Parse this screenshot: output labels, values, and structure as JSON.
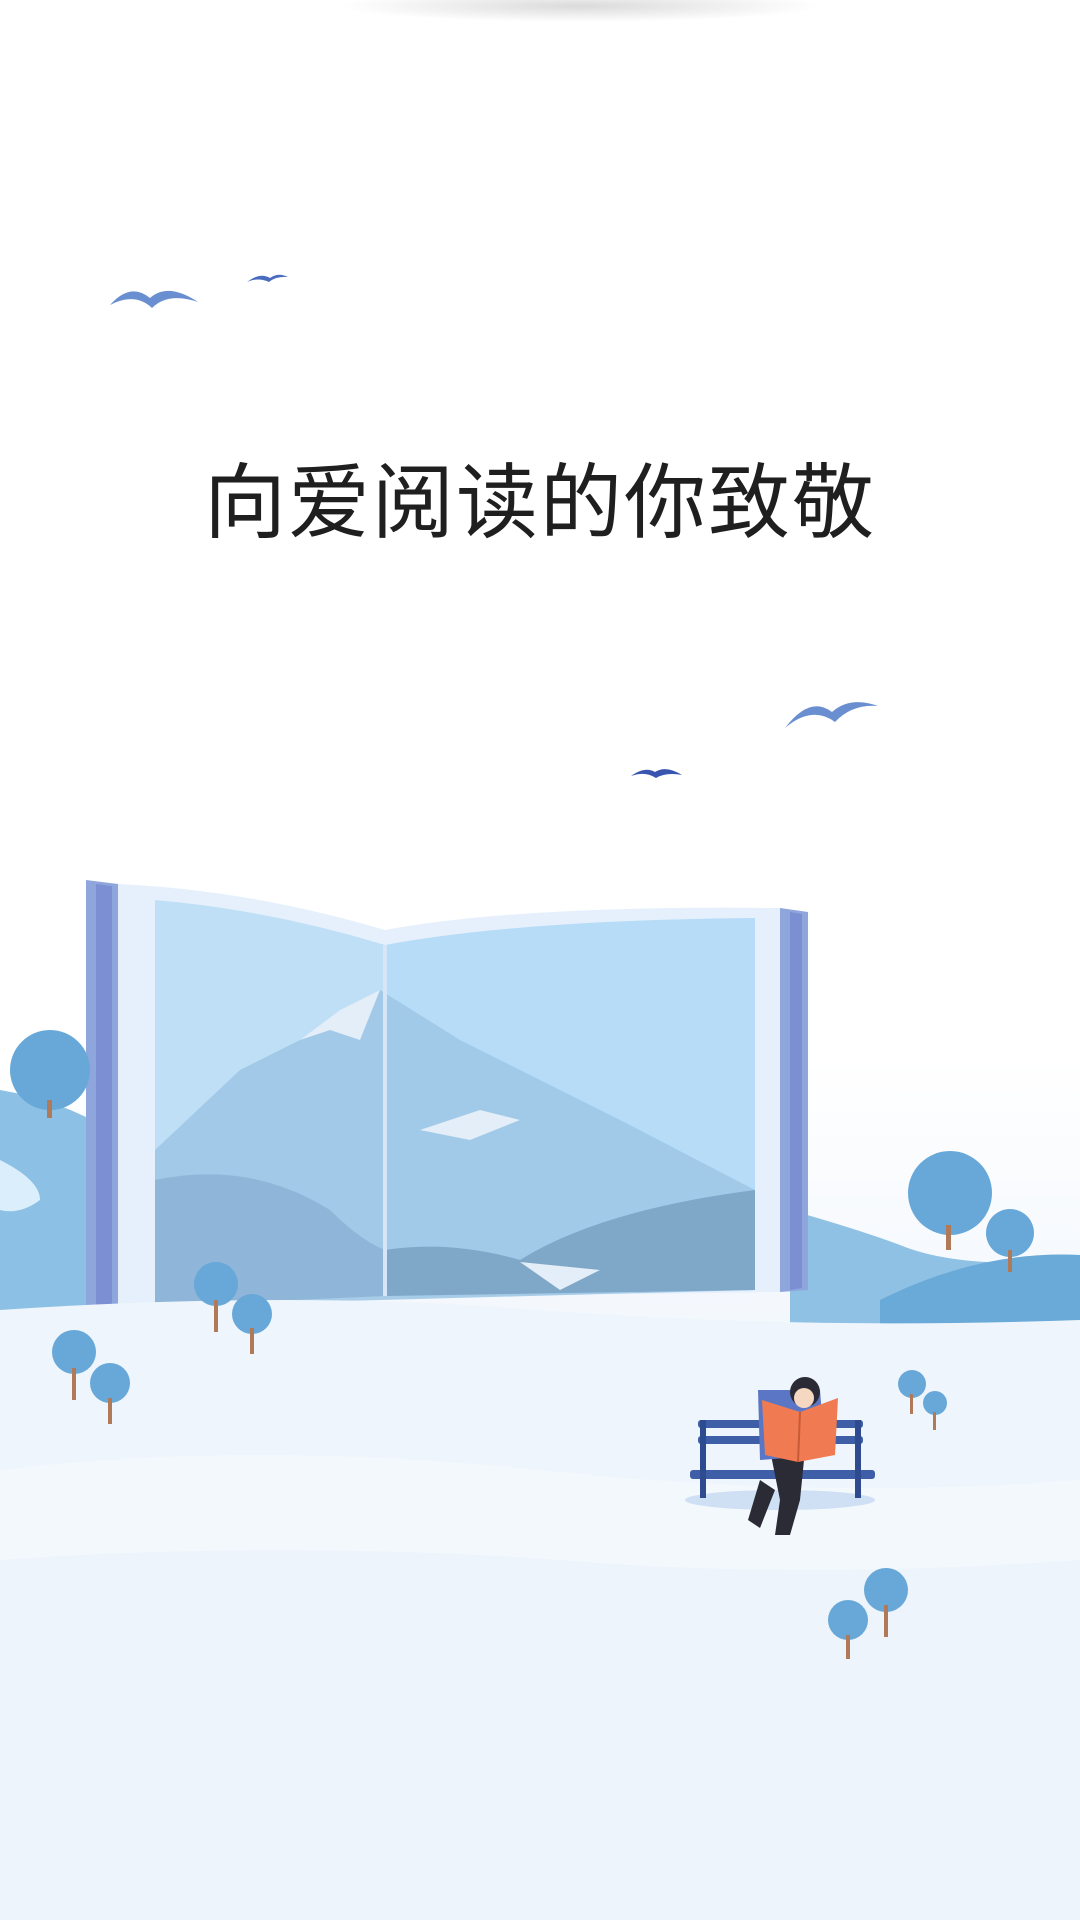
{
  "splash": {
    "slogan": "向爱阅读的你致敬"
  },
  "illustration": {
    "icons": [
      "bird-icon",
      "open-book",
      "mountains",
      "tree-icon",
      "bench",
      "reader-figure"
    ],
    "colors": {
      "sky_blue": "#b9dcf7",
      "mountain_blue": "#7fb2d6",
      "hill_blue": "#6aaad8",
      "tree_blue": "#67a8d8",
      "bird_blue": "#6a8fd0",
      "bench_blue": "#3e5ea8",
      "book_orange": "#f07b52",
      "snow": "#eef5fc"
    }
  }
}
